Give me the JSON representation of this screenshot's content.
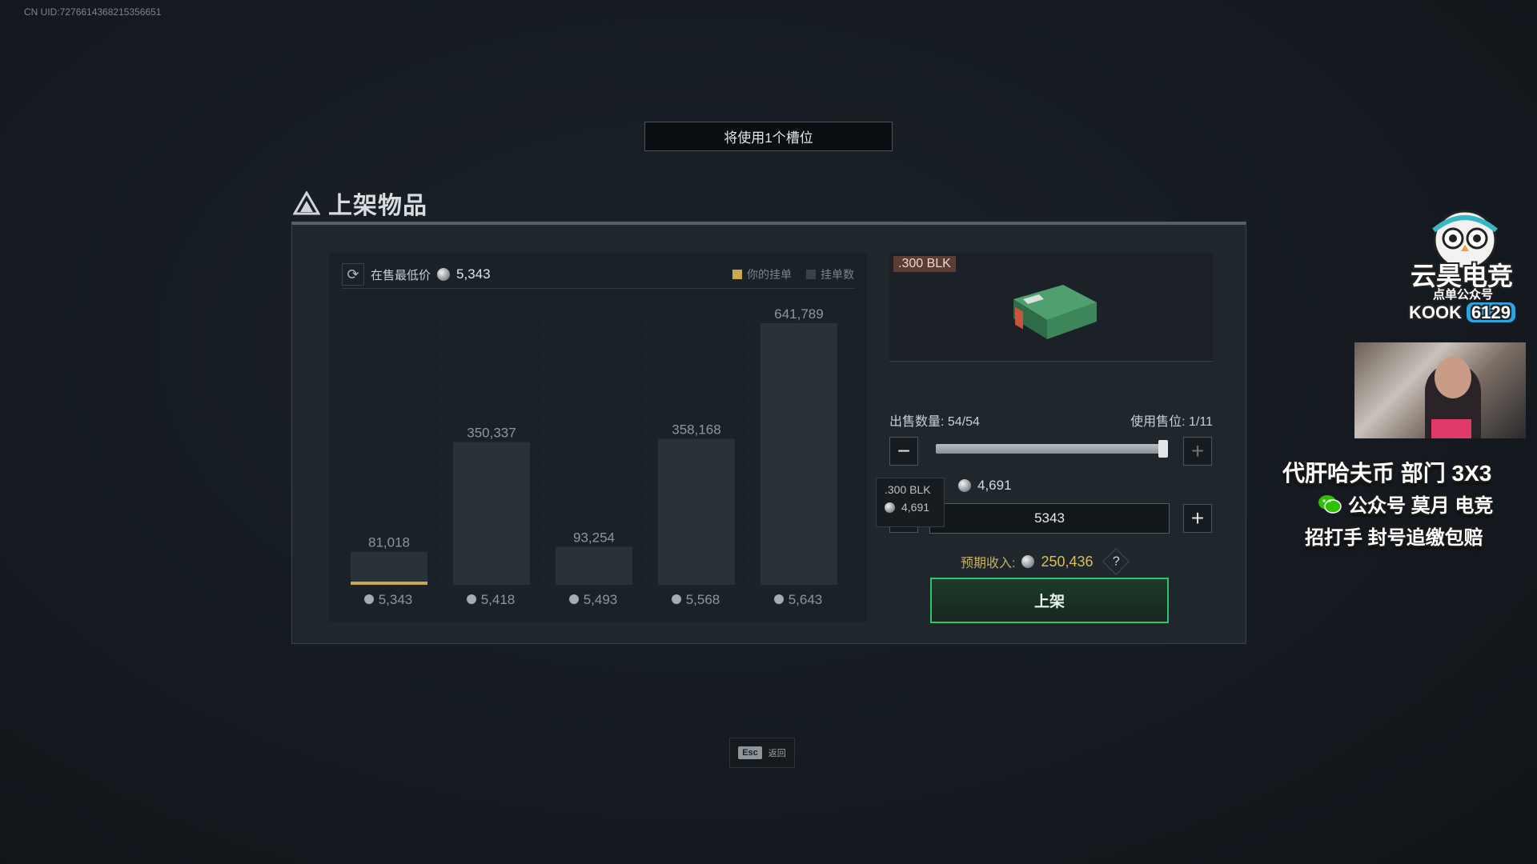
{
  "uid": "CN UID:7276614368215356651",
  "slot_banner": "将使用1个槽位",
  "panel_title": "上架物品",
  "chart_header": {
    "lowest_label": "在售最低价",
    "lowest_value": "5,343",
    "legend_yours": "你的挂单",
    "legend_count": "挂单数"
  },
  "colors": {
    "accent_green": "#2fc36d",
    "yours_gold": "#c9a94f",
    "item_tag": "#5b3d35"
  },
  "chart_data": {
    "type": "bar",
    "categories": [
      "5,343",
      "5,418",
      "5,493",
      "5,568",
      "5,643"
    ],
    "values": [
      81018,
      350337,
      93254,
      358168,
      641789
    ],
    "value_labels": [
      "81,018",
      "350,337",
      "93,254",
      "358,168",
      "641,789"
    ],
    "highlight_index": 0,
    "series": [
      {
        "name": "挂单数",
        "values": [
          81018,
          350337,
          93254,
          358168,
          641789
        ]
      }
    ],
    "xlabel": "",
    "ylabel": "",
    "legend": "top-right"
  },
  "item": {
    "name": ".300 BLK"
  },
  "quantity": {
    "label": "出售数量:",
    "value": "54/54",
    "max": 54,
    "current": 54
  },
  "slots": {
    "label": "使用售位:",
    "value": "1/11"
  },
  "slider_fraction": 1.0,
  "unit_price": "4,691",
  "tooltip": {
    "name": ".300 BLK",
    "price": "4,691"
  },
  "price_input": "5343",
  "income": {
    "label": "预期收入:",
    "value": "250,436",
    "help": "?"
  },
  "list_button": "上架",
  "esc": {
    "key": "Esc",
    "label": "返回"
  },
  "overlay": {
    "brand": "云昊电竞",
    "brand_sub": "点单公众号",
    "kook_label": "KOOK",
    "kook_number": "6129",
    "line1": "代肝哈夫币 部门 3X3",
    "line2": "公众号 莫月 电竞",
    "line3": "招打手 封号追缴包赔"
  }
}
